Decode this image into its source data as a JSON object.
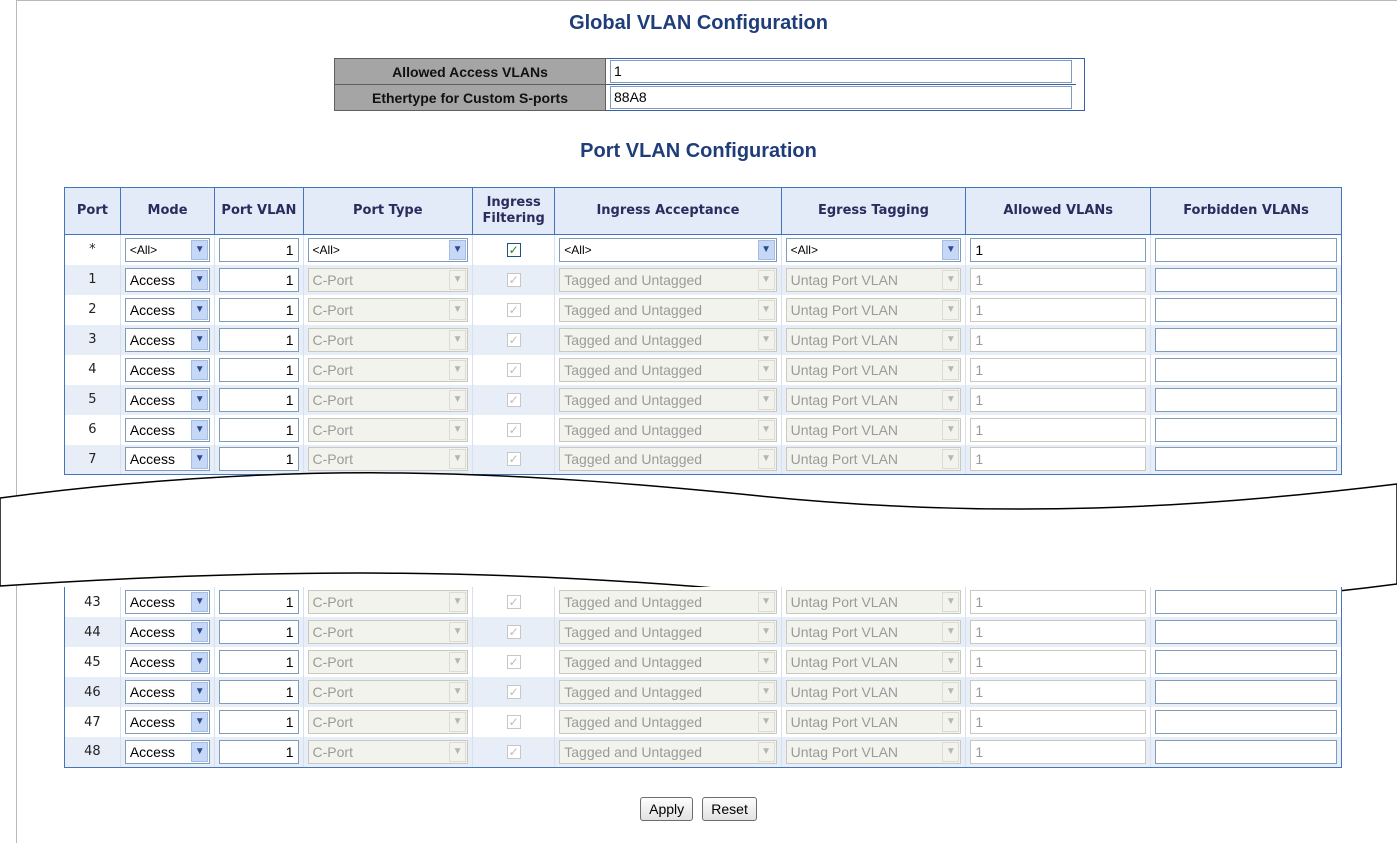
{
  "global": {
    "title": "Global VLAN Configuration",
    "allowed_access_label": "Allowed Access VLANs",
    "allowed_access_value": "1",
    "ethertype_label": "Ethertype for Custom S-ports",
    "ethertype_value": "88A8"
  },
  "port_config": {
    "title": "Port VLAN Configuration",
    "headers": {
      "port": "Port",
      "mode": "Mode",
      "port_vlan": "Port VLAN",
      "port_type": "Port Type",
      "ingress_filtering": "Ingress Filtering",
      "ingress_acceptance": "Ingress Acceptance",
      "egress_tagging": "Egress Tagging",
      "allowed_vlans": "Allowed VLANs",
      "forbidden_vlans": "Forbidden VLANs"
    },
    "all_row": {
      "port": "*",
      "mode": "<All>",
      "port_vlan": "1",
      "port_type": "<All>",
      "ingress_filtering": true,
      "ingress_acceptance": "<All>",
      "egress_tagging": "<All>",
      "allowed_vlans": "1",
      "forbidden_vlans": ""
    },
    "rows_top": [
      {
        "port": "1",
        "mode": "Access",
        "port_vlan": "1",
        "port_type": "C-Port",
        "ingress_filtering": true,
        "ingress_acceptance": "Tagged and Untagged",
        "egress_tagging": "Untag Port VLAN",
        "allowed_vlans": "1",
        "forbidden_vlans": ""
      },
      {
        "port": "2",
        "mode": "Access",
        "port_vlan": "1",
        "port_type": "C-Port",
        "ingress_filtering": true,
        "ingress_acceptance": "Tagged and Untagged",
        "egress_tagging": "Untag Port VLAN",
        "allowed_vlans": "1",
        "forbidden_vlans": ""
      },
      {
        "port": "3",
        "mode": "Access",
        "port_vlan": "1",
        "port_type": "C-Port",
        "ingress_filtering": true,
        "ingress_acceptance": "Tagged and Untagged",
        "egress_tagging": "Untag Port VLAN",
        "allowed_vlans": "1",
        "forbidden_vlans": ""
      },
      {
        "port": "4",
        "mode": "Access",
        "port_vlan": "1",
        "port_type": "C-Port",
        "ingress_filtering": true,
        "ingress_acceptance": "Tagged and Untagged",
        "egress_tagging": "Untag Port VLAN",
        "allowed_vlans": "1",
        "forbidden_vlans": ""
      },
      {
        "port": "5",
        "mode": "Access",
        "port_vlan": "1",
        "port_type": "C-Port",
        "ingress_filtering": true,
        "ingress_acceptance": "Tagged and Untagged",
        "egress_tagging": "Untag Port VLAN",
        "allowed_vlans": "1",
        "forbidden_vlans": ""
      },
      {
        "port": "6",
        "mode": "Access",
        "port_vlan": "1",
        "port_type": "C-Port",
        "ingress_filtering": true,
        "ingress_acceptance": "Tagged and Untagged",
        "egress_tagging": "Untag Port VLAN",
        "allowed_vlans": "1",
        "forbidden_vlans": ""
      },
      {
        "port": "7",
        "mode": "Access",
        "port_vlan": "1",
        "port_type": "C-Port",
        "ingress_filtering": true,
        "ingress_acceptance": "Tagged and Untagged",
        "egress_tagging": "Untag Port VLAN",
        "allowed_vlans": "1",
        "forbidden_vlans": ""
      }
    ],
    "rows_bottom": [
      {
        "port": "43",
        "mode": "Access",
        "port_vlan": "1",
        "port_type": "C-Port",
        "ingress_filtering": true,
        "ingress_acceptance": "Tagged and Untagged",
        "egress_tagging": "Untag Port VLAN",
        "allowed_vlans": "1",
        "forbidden_vlans": ""
      },
      {
        "port": "44",
        "mode": "Access",
        "port_vlan": "1",
        "port_type": "C-Port",
        "ingress_filtering": true,
        "ingress_acceptance": "Tagged and Untagged",
        "egress_tagging": "Untag Port VLAN",
        "allowed_vlans": "1",
        "forbidden_vlans": ""
      },
      {
        "port": "45",
        "mode": "Access",
        "port_vlan": "1",
        "port_type": "C-Port",
        "ingress_filtering": true,
        "ingress_acceptance": "Tagged and Untagged",
        "egress_tagging": "Untag Port VLAN",
        "allowed_vlans": "1",
        "forbidden_vlans": ""
      },
      {
        "port": "46",
        "mode": "Access",
        "port_vlan": "1",
        "port_type": "C-Port",
        "ingress_filtering": true,
        "ingress_acceptance": "Tagged and Untagged",
        "egress_tagging": "Untag Port VLAN",
        "allowed_vlans": "1",
        "forbidden_vlans": ""
      },
      {
        "port": "47",
        "mode": "Access",
        "port_vlan": "1",
        "port_type": "C-Port",
        "ingress_filtering": true,
        "ingress_acceptance": "Tagged and Untagged",
        "egress_tagging": "Untag Port VLAN",
        "allowed_vlans": "1",
        "forbidden_vlans": ""
      },
      {
        "port": "48",
        "mode": "Access",
        "port_vlan": "1",
        "port_type": "C-Port",
        "ingress_filtering": true,
        "ingress_acceptance": "Tagged and Untagged",
        "egress_tagging": "Untag Port VLAN",
        "allowed_vlans": "1",
        "forbidden_vlans": ""
      }
    ]
  },
  "buttons": {
    "apply": "Apply",
    "reset": "Reset"
  },
  "icons": {
    "dropdown": "chevron-down-icon",
    "checkbox": "checkmark-icon"
  },
  "colors": {
    "title": "#1f3d78",
    "header_bg": "#e2ebf7",
    "border": "#4474bc",
    "row_alt": "#e8eef8"
  }
}
